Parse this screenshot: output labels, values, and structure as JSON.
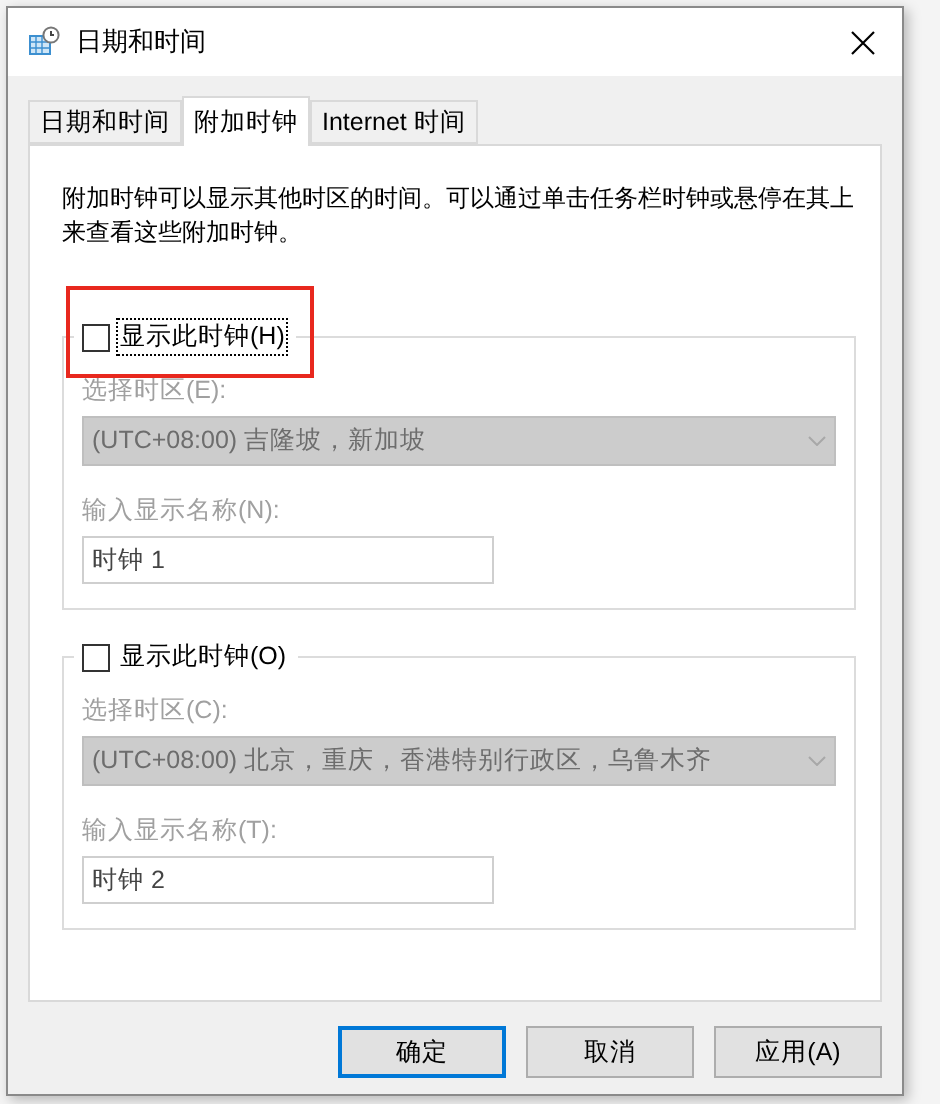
{
  "window": {
    "title": "日期和时间"
  },
  "tabs": [
    {
      "label": "日期和时间",
      "selected": false
    },
    {
      "label": "附加时钟",
      "selected": true
    },
    {
      "label": "Internet 时间",
      "selected": false
    }
  ],
  "description": "附加时钟可以显示其他时区的时间。可以通过单击任务栏时钟或悬停在其上来查看这些附加时钟。",
  "clocks": [
    {
      "show_label": "显示此时钟(H)",
      "checked": false,
      "focused": true,
      "highlighted": true,
      "disabled": true,
      "zone_label": "选择时区(E):",
      "zone": "(UTC+08:00) 吉隆坡，新加坡",
      "name_label": "输入显示名称(N):",
      "name": "时钟 1"
    },
    {
      "show_label": "显示此时钟(O)",
      "checked": false,
      "focused": false,
      "highlighted": false,
      "disabled": true,
      "zone_label": "选择时区(C):",
      "zone": "(UTC+08:00) 北京，重庆，香港特别行政区，乌鲁木齐",
      "name_label": "输入显示名称(T):",
      "name": "时钟 2"
    }
  ],
  "buttons": [
    {
      "label": "确定",
      "default": true
    },
    {
      "label": "取消",
      "default": false
    },
    {
      "label": "应用(A)",
      "default": false
    }
  ]
}
